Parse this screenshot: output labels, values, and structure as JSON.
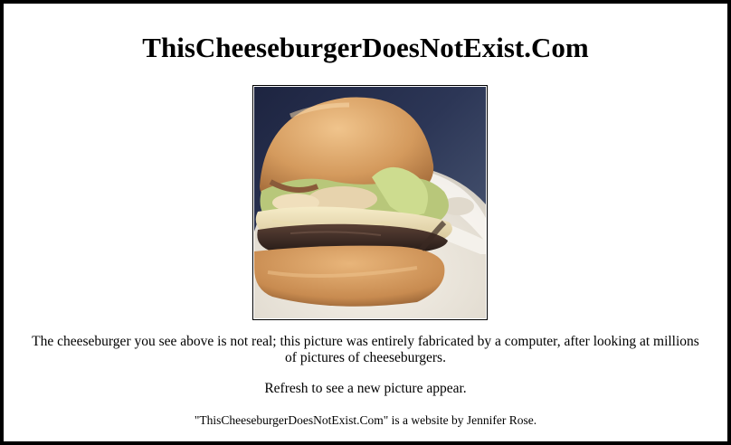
{
  "page": {
    "title": "ThisCheeseburgerDoesNotExist.Com",
    "description": "The cheeseburger you see above is not real; this picture was entirely fabricated by a computer, after looking at millions of pictures of cheeseburgers.",
    "refresh_note": "Refresh to see a new picture appear.",
    "credit": "\"ThisCheeseburgerDoesNotExist.Com\" is a website by Jennifer Rose."
  },
  "image": {
    "subject": "generated-cheeseburger-photo",
    "colors": {
      "background": "#2c3656",
      "plate": "#e6e3dc",
      "bun": "#d9a36a",
      "lettuce": "#b7c77b",
      "cheese": "#eee2b5",
      "patty": "#3b2a24"
    }
  }
}
